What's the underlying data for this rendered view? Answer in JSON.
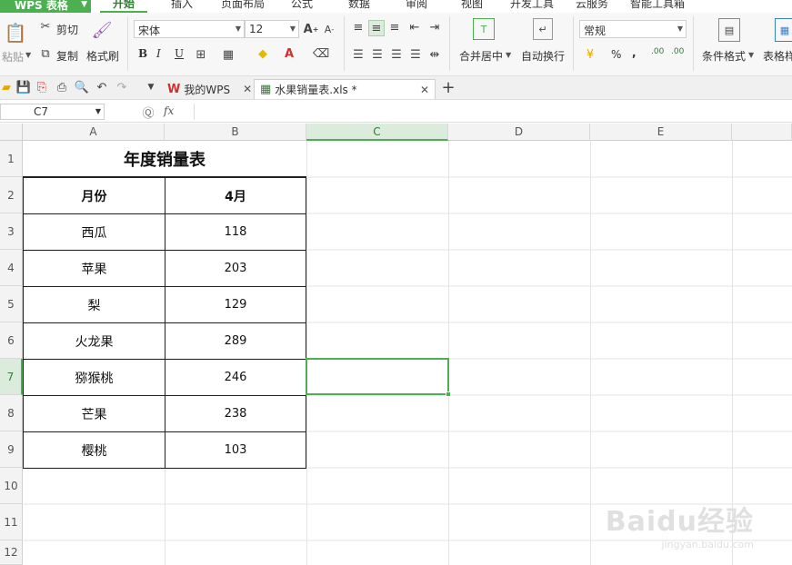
{
  "app": {
    "name": "WPS 表格"
  },
  "menu": {
    "tabs": [
      "开始",
      "插入",
      "页面布局",
      "公式",
      "数据",
      "审阅",
      "视图",
      "开发工具",
      "云服务",
      "智能工具箱"
    ]
  },
  "ribbon": {
    "paste": "粘贴",
    "cut": "剪切",
    "copy": "复制",
    "format_painter": "格式刷",
    "font_name": "宋体",
    "font_size": "12",
    "bold": "B",
    "italic": "I",
    "underline": "U",
    "merge_center": "合并居中",
    "wrap_text": "自动换行",
    "number_format": "常规",
    "percent": "%",
    "comma": ",",
    "inc_decimal": ".00",
    "cond_format": "条件格式",
    "table_style": "表格样"
  },
  "documents": {
    "tab1": "我的WPS",
    "tab2": "水果销量表.xls *"
  },
  "formula_bar": {
    "name_box": "C7",
    "fx": "fx",
    "value": ""
  },
  "sheet": {
    "columns": [
      "A",
      "B",
      "C",
      "D",
      "E"
    ],
    "rows": [
      "1",
      "2",
      "3",
      "4",
      "5",
      "6",
      "7",
      "8",
      "9",
      "10",
      "11",
      "12"
    ],
    "title": "年度销量表",
    "header": {
      "fruit": "月份",
      "month": "4月"
    },
    "data": [
      {
        "fruit": "西瓜",
        "value": "118"
      },
      {
        "fruit": "苹果",
        "value": "203"
      },
      {
        "fruit": "梨",
        "value": "129"
      },
      {
        "fruit": "火龙果",
        "value": "289"
      },
      {
        "fruit": "猕猴桃",
        "value": "246"
      },
      {
        "fruit": "芒果",
        "value": "238"
      },
      {
        "fruit": "樱桃",
        "value": "103"
      }
    ],
    "selected_cell": "C7"
  },
  "watermark": {
    "main": "Baidu经验",
    "sub": "jingyan.baidu.com"
  },
  "colors": {
    "accent": "#4caf50",
    "ribbon_bg": "#f7f7f7"
  }
}
